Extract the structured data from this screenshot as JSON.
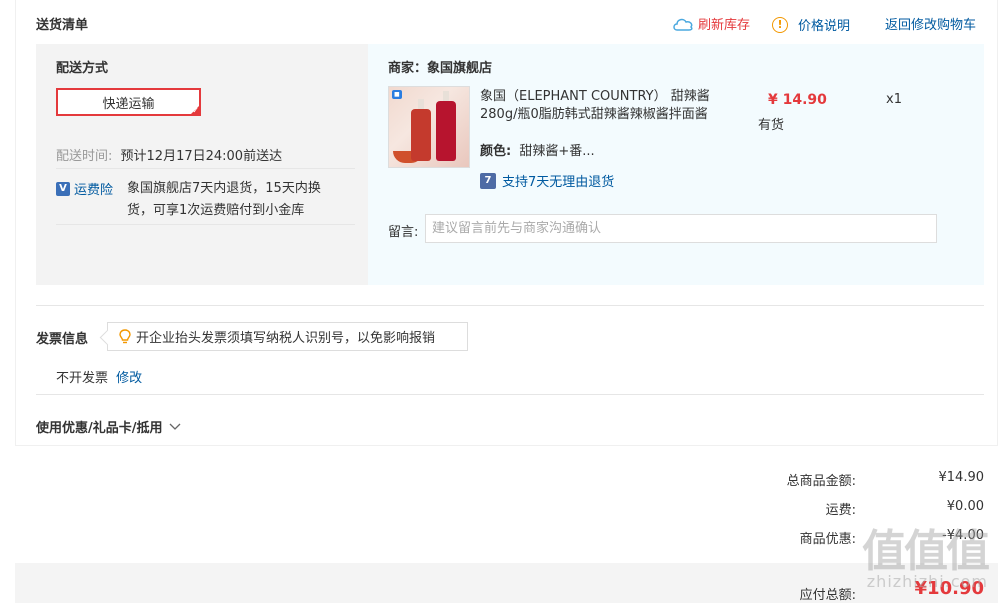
{
  "header": {
    "title": "送货清单",
    "refresh_stock": "刷新库存",
    "price_note": "价格说明",
    "back_to_cart": "返回修改购物车"
  },
  "shipping": {
    "method_label": "配送方式",
    "method_selected": "快递运输",
    "time_label": "配送时间:",
    "time_value": "预计12月17日24:00前送达",
    "insurance_label": "运费险",
    "insurance_desc_line1": "象国旗舰店7天内退货，15天内换",
    "insurance_desc_line2": "货，可享1次运费赔付到小金库"
  },
  "store": {
    "label": "商家：象国旗舰店",
    "product": {
      "name_line1": "象国（ELEPHANT COUNTRY） 甜辣酱",
      "name_line2": "280g/瓶0脂肪韩式甜辣酱辣椒酱拌面酱",
      "color_label": "颜色:",
      "color_value": "甜辣酱+番...",
      "price": "¥ 14.90",
      "stock": "有货",
      "qty": "x1",
      "return_policy": "支持7天无理由退货",
      "return_icon": "7"
    },
    "remark_label": "留言:",
    "remark_placeholder": "建议留言前先与商家沟通确认"
  },
  "invoice": {
    "title": "发票信息",
    "tip": "开企业抬头发票须填写纳税人识别号，以免影响报销",
    "status": "不开发票",
    "edit": "修改"
  },
  "coupon": {
    "title": "使用优惠/礼品卡/抵用"
  },
  "summary": {
    "goods_label": "总商品金额:",
    "goods_value": "¥14.90",
    "freight_label": "运费:",
    "freight_value": "¥0.00",
    "discount_label": "商品优惠:",
    "discount_value": "-¥4.00",
    "total_label": "应付总额:",
    "total_value": "¥10.90"
  },
  "watermark": {
    "text": "值值值",
    "site": "zhizhizhi.com"
  }
}
